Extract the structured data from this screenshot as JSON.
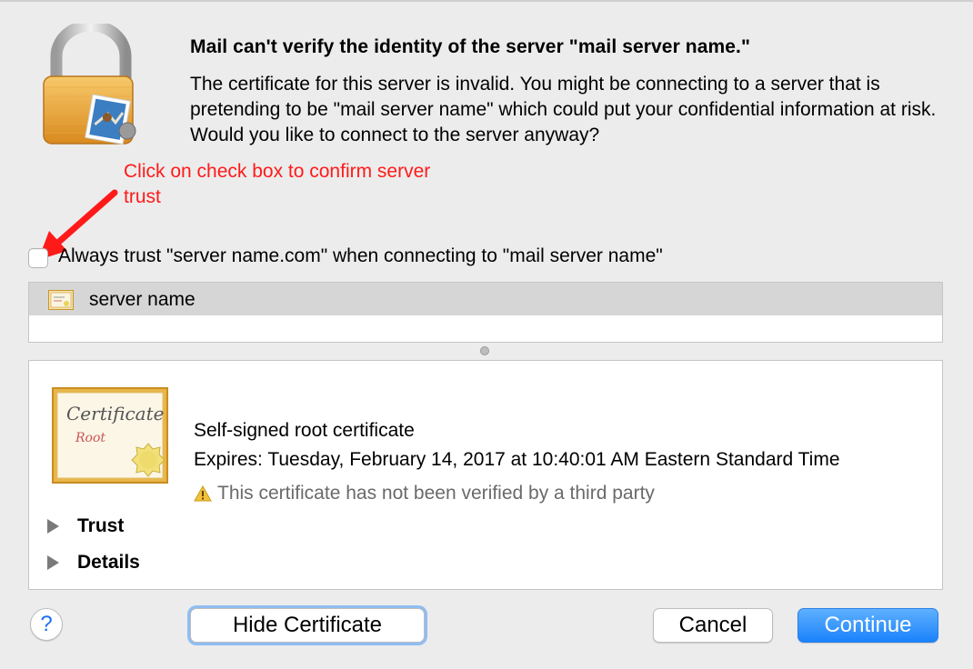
{
  "dialog": {
    "title": "Mail can't verify the identity of the server \"mail server name.\"",
    "message": "The certificate for this server is invalid. You might be connecting to a server that is pretending to be \"mail server name\" which could put your confidential information at risk. Would you like to connect to the server anyway?",
    "icon": "lock-with-mail-stamp-icon"
  },
  "annotation": {
    "text": "Click on check box to confirm server trust",
    "color": "#ff1a1a"
  },
  "trust_checkbox": {
    "label": "Always trust \"server name.com\" when connecting to \"mail server name\"",
    "checked": false
  },
  "cert_list": {
    "items": [
      {
        "label": "server name",
        "icon": "certificate-icon",
        "selected": true
      }
    ]
  },
  "cert_detail": {
    "icon_text_1": "Certificate",
    "icon_text_2": "Root",
    "name": "Self-signed root certificate",
    "expires": "Expires: Tuesday, February 14, 2017 at 10:40:01 AM Eastern Standard Time",
    "warning": "This certificate has not been verified by a third party",
    "sections": [
      {
        "label": "Trust",
        "expanded": false
      },
      {
        "label": "Details",
        "expanded": false
      }
    ]
  },
  "buttons": {
    "help": "?",
    "hide_certificate": "Hide Certificate",
    "cancel": "Cancel",
    "continue": "Continue"
  },
  "colors": {
    "accent": "#1a82fb",
    "background": "#ececec"
  }
}
